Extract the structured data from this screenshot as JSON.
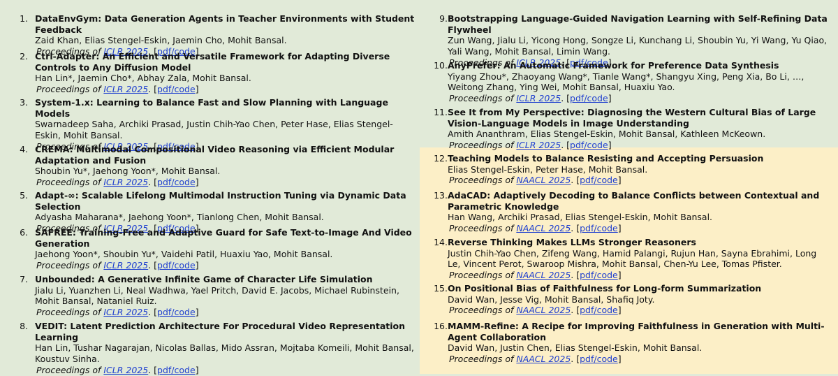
{
  "entries": [
    {
      "num": "1.",
      "title": "DataEnvGym: Data Generation Agents in Teacher Environments with Student Feedback",
      "authors": "Zaid Khan, Elias Stengel-Eskin, Jaemin Cho, Mohit Bansal.",
      "prefix": "Proceedings of ",
      "venue": "ICLR 2025",
      "sep": ". [",
      "pdf": "pdf/code",
      "close": "]"
    },
    {
      "num": "2.",
      "title": "Ctrl-Adapter: An Efficient and Versatile Framework for Adapting Diverse Controls to Any Diffusion Model",
      "authors": "Han Lin*, Jaemin Cho*, Abhay Zala, Mohit Bansal.",
      "prefix": "Proceedings of ",
      "venue": "ICLR 2025",
      "sep": ". [",
      "pdf": "pdf/code",
      "close": "]"
    },
    {
      "num": "3.",
      "title": "System-1.x: Learning to Balance Fast and Slow Planning with Language Models",
      "authors": "Swarnadeep Saha, Archiki Prasad, Justin Chih-Yao Chen, Peter Hase, Elias Stengel-Eskin, Mohit Bansal.",
      "prefix": "Proceedings of ",
      "venue": "ICLR 2025",
      "sep": ". [",
      "pdf": "pdf/code",
      "close": "]"
    },
    {
      "num": "4.",
      "title": "CREMA: Multimodal Compositional Video Reasoning via Efficient Modular Adaptation and Fusion",
      "authors": "Shoubin Yu*, Jaehong Yoon*, Mohit Bansal.",
      "prefix": "Proceedings of ",
      "venue": "ICLR 2025",
      "sep": ". [",
      "pdf": "pdf/code",
      "close": "]"
    },
    {
      "num": "5.",
      "title": "Adapt-∞: Scalable Lifelong Multimodal Instruction Tuning via Dynamic Data Selection",
      "authors": "Adyasha Maharana*, Jaehong Yoon*, Tianlong Chen, Mohit Bansal.",
      "prefix": "Proceedings of ",
      "venue": "ICLR 2025",
      "sep": ". [",
      "pdf": "pdf/code",
      "close": "]"
    },
    {
      "num": "6.",
      "title": "SAFREE: Training-Free and Adaptive Guard for Safe Text-to-Image And Video Generation",
      "authors": "Jaehong Yoon*, Shoubin Yu*, Vaidehi Patil, Huaxiu Yao, Mohit Bansal.",
      "prefix": "Proceedings of ",
      "venue": "ICLR 2025",
      "sep": ". [",
      "pdf": "pdf/code",
      "close": "]"
    },
    {
      "num": "7.",
      "title": "Unbounded: A Generative Infinite Game of Character Life Simulation",
      "authors": "Jialu Li, Yuanzhen Li, Neal Wadhwa, Yael Pritch, David E. Jacobs, Michael Rubinstein, Mohit Bansal, Nataniel Ruiz.",
      "prefix": "Proceedings of ",
      "venue": "ICLR 2025",
      "sep": ". [",
      "pdf": "pdf/code",
      "close": "]"
    },
    {
      "num": "8.",
      "title": "VEDIT: Latent Prediction Architecture For Procedural Video Representation Learning",
      "authors": "Han Lin, Tushar Nagarajan, Nicolas Ballas, Mido Assran, Mojtaba Komeili, Mohit Bansal, Koustuv Sinha.",
      "prefix": "Proceedings of ",
      "venue": "ICLR 2025",
      "sep": ". [",
      "pdf": "pdf/code",
      "close": "]"
    },
    {
      "num": "9.",
      "title": "Bootstrapping Language-Guided Navigation Learning with Self-Refining Data Flywheel",
      "authors": "Zun Wang, Jialu Li, Yicong Hong, Songze Li, Kunchang Li, Shoubin Yu, Yi Wang, Yu Qiao, Yali Wang, Mohit Bansal, Limin Wang.",
      "prefix": "Proceedings of ",
      "venue": "ICLR 2025",
      "sep": ". [",
      "pdf": "pdf/code",
      "close": "]"
    },
    {
      "num": "10.",
      "title": "AnyPrefer: An Automatic Framework for Preference Data Synthesis",
      "authors": "Yiyang Zhou*, Zhaoyang Wang*, Tianle Wang*, Shangyu Xing, Peng Xia, Bo Li, …, Weitong Zhang, Ying Wei, Mohit Bansal, Huaxiu Yao.",
      "prefix": "Proceedings of ",
      "venue": "ICLR 2025",
      "sep": ". [",
      "pdf": "pdf/code",
      "close": "]"
    },
    {
      "num": "11.",
      "title": "See It from My Perspective: Diagnosing the Western Cultural Bias of Large Vision-Language Models in Image Understanding",
      "authors": "Amith Ananthram, Elias Stengel-Eskin, Mohit Bansal, Kathleen McKeown.",
      "prefix": "Proceedings of ",
      "venue": "ICLR 2025",
      "sep": ". [",
      "pdf": "pdf/code",
      "close": "]"
    },
    {
      "num": "12.",
      "title": "Teaching Models to Balance Resisting and Accepting Persuasion",
      "authors": "Elias Stengel-Eskin, Peter Hase, Mohit Bansal.",
      "prefix": "Proceedings of ",
      "venue": "NAACL 2025",
      "sep": ". [",
      "pdf": "pdf/code",
      "close": "]"
    },
    {
      "num": "13.",
      "title": "AdaCAD: Adaptively Decoding to Balance Conflicts between Contextual and Parametric Knowledge",
      "authors": "Han Wang, Archiki Prasad, Elias Stengel-Eskin, Mohit Bansal.",
      "prefix": "Proceedings of ",
      "venue": "NAACL 2025",
      "sep": ". [",
      "pdf": "pdf/code",
      "close": "]"
    },
    {
      "num": "14.",
      "title": "Reverse Thinking Makes LLMs Stronger Reasoners",
      "authors": "Justin Chih-Yao Chen, Zifeng Wang, Hamid Palangi, Rujun Han, Sayna Ebrahimi, Long Le, Vincent Perot, Swaroop Mishra, Mohit Bansal, Chen-Yu Lee, Tomas Pfister.",
      "prefix": "Proceedings of ",
      "venue": "NAACL 2025",
      "sep": ". [",
      "pdf": "pdf/code",
      "close": "]"
    },
    {
      "num": "15.",
      "title": "On Positional Bias of Faithfulness for Long-form Summarization",
      "authors": "David Wan, Jesse Vig, Mohit Bansal, Shafiq Joty.",
      "prefix": "Proceedings of ",
      "venue": "NAACL 2025",
      "sep": ". [",
      "pdf": "pdf/code",
      "close": "]"
    },
    {
      "num": "16.",
      "title": "MAMM-Refine: A Recipe for Improving Faithfulness in Generation with Multi-Agent Collaboration",
      "authors": "David Wan, Justin Chen, Elias Stengel-Eskin, Mohit Bansal.",
      "prefix": "Proceedings of ",
      "venue": "NAACL 2025",
      "sep": ". [",
      "pdf": "pdf/code",
      "close": "]"
    }
  ]
}
